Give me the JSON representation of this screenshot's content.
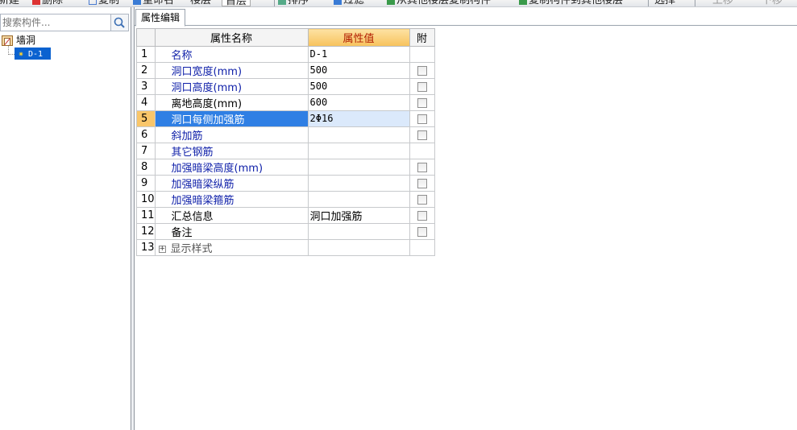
{
  "toolbar": {
    "items": [
      {
        "label": "新建"
      },
      {
        "label": "删除"
      },
      {
        "label": "复制"
      },
      {
        "label": "重命名"
      },
      {
        "label": "楼层"
      },
      {
        "label": "首层"
      },
      {
        "label": "排序"
      },
      {
        "label": "过滤"
      },
      {
        "label": "从其他楼层复制构件"
      },
      {
        "label": "复制构件到其他楼层"
      },
      {
        "label": "选择"
      },
      {
        "label": "上移"
      },
      {
        "label": "下移"
      }
    ]
  },
  "left": {
    "search_placeholder": "搜索构件...",
    "tree": {
      "root_label": "墙洞",
      "child_label": "D-1"
    }
  },
  "right": {
    "tab_label": "属性编辑",
    "columns": {
      "name": "属性名称",
      "value": "属性值",
      "extra": "附"
    },
    "rows": [
      {
        "num": "1",
        "name": "名称",
        "value": "D-1"
      },
      {
        "num": "2",
        "name": "洞口宽度(mm)",
        "value": "500"
      },
      {
        "num": "3",
        "name": "洞口高度(mm)",
        "value": "500"
      },
      {
        "num": "4",
        "name": "离地高度(mm)",
        "value": "600"
      },
      {
        "num": "5",
        "name": "洞口每侧加强筋",
        "value": "2Φ16"
      },
      {
        "num": "6",
        "name": "斜加筋",
        "value": ""
      },
      {
        "num": "7",
        "name": "其它钢筋",
        "value": ""
      },
      {
        "num": "8",
        "name": "加强暗梁高度(mm)",
        "value": ""
      },
      {
        "num": "9",
        "name": "加强暗梁纵筋",
        "value": ""
      },
      {
        "num": "10",
        "name": "加强暗梁箍筋",
        "value": ""
      },
      {
        "num": "11",
        "name": "汇总信息",
        "value": "洞口加强筋"
      },
      {
        "num": "12",
        "name": "备注",
        "value": ""
      },
      {
        "num": "13",
        "name": "显示样式",
        "value": ""
      }
    ]
  }
}
